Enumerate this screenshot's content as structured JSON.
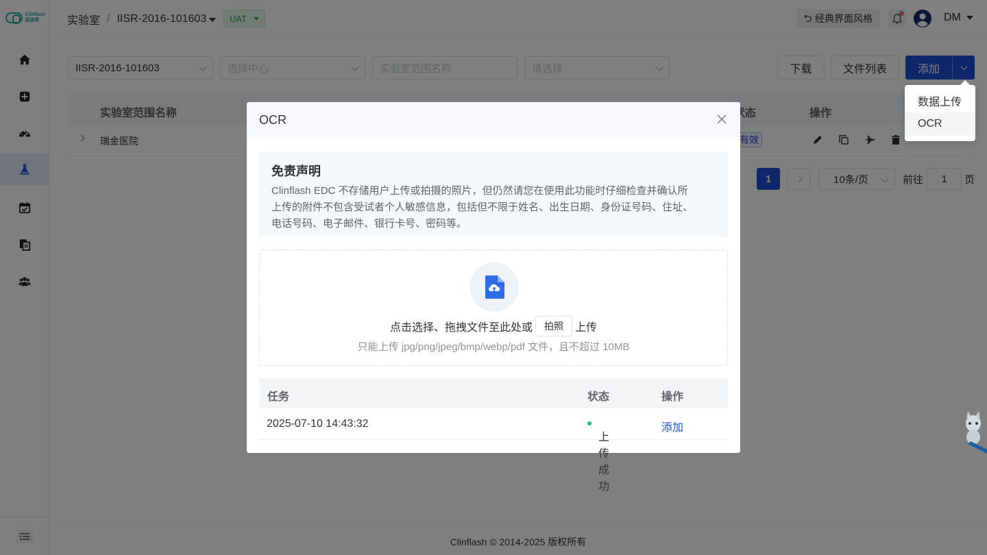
{
  "app": {
    "logo_text_top": "Clinflash",
    "logo_text_bottom": "易迪希"
  },
  "header": {
    "breadcrumb_root": "实验室",
    "breadcrumb_sep": "/",
    "study": "IISR-2016-101603",
    "env": "UAT",
    "classic_style": "经典界面风格",
    "user": "DM"
  },
  "sidebar": {
    "items": [
      {
        "icon": "home-icon"
      },
      {
        "icon": "plus-square-icon"
      },
      {
        "icon": "dashboard-icon"
      },
      {
        "icon": "flask-icon",
        "active": true
      },
      {
        "icon": "calendar-check-icon"
      },
      {
        "icon": "documents-icon"
      },
      {
        "icon": "users-icon"
      }
    ]
  },
  "filters": {
    "study_select": "IISR-2016-101603",
    "center_placeholder": "选择中心",
    "range_name_placeholder": "实验室范围名称",
    "select_placeholder": "请选择"
  },
  "toolbar": {
    "download": "下载",
    "file_list": "文件列表",
    "add": "添加"
  },
  "dropdown": {
    "items": [
      "数据上传",
      "OCR"
    ]
  },
  "table": {
    "col_name": "实验室范围名称",
    "col_status": "状态",
    "col_ops": "操作",
    "rows": [
      {
        "name": "瑞金医院",
        "status": "有效"
      }
    ]
  },
  "pagination": {
    "current": "1",
    "page_size": "10条/页",
    "goto_label": "前往",
    "goto_value": "1",
    "page_suffix": "页"
  },
  "footer": {
    "text": "Clinflash © 2014-2025 版权所有"
  },
  "modal": {
    "title": "OCR",
    "disclaimer_title": "免责声明",
    "disclaimer_line1": "Clinflash EDC 不存储用户上传或拍摄的照片，但仍然请您在使用此功能时仔细检查并确认所",
    "disclaimer_line2": "上传的附件不包含受试者个人敏感信息，包括但不限于姓名、出生日期、身份证号码、住址、",
    "disclaimer_line3": "电话号码、电子邮件、银行卡号、密码等。",
    "upload_text_before": "点击选择、拖拽文件至此处或",
    "photo_button": "拍照",
    "upload_text_after": "上传",
    "upload_hint": "只能上传 jpg/png/jpeg/bmp/webp/pdf 文件，且不超过 10MB",
    "task_col_task": "任务",
    "task_col_status": "状态",
    "task_col_ops": "操作",
    "tasks": [
      {
        "task": "2025-07-10 14:43:32",
        "status": "上传成功",
        "action": "添加"
      }
    ]
  },
  "colors": {
    "primary": "#1f4fd4",
    "success": "#13c26b",
    "env_green": "#2aa149",
    "badge_red": "#f56c6c"
  }
}
